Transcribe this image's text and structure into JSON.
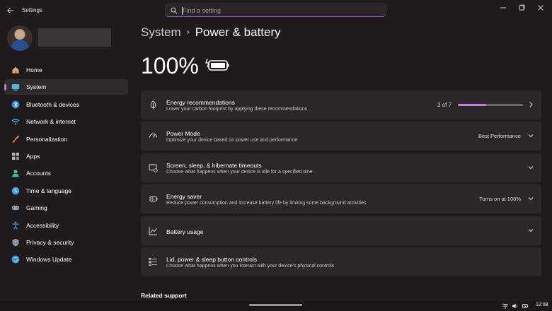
{
  "window": {
    "title": "Settings",
    "back_icon": "back-arrow-icon",
    "controls": [
      "minimize-icon",
      "maximize-icon",
      "close-icon"
    ]
  },
  "search": {
    "placeholder": "Find a setting",
    "icon": "search-icon"
  },
  "sidebar": {
    "items": [
      {
        "label": "Home",
        "icon": "home-icon",
        "active": false
      },
      {
        "label": "System",
        "icon": "system-display-icon",
        "active": true
      },
      {
        "label": "Bluetooth & devices",
        "icon": "bluetooth-icon",
        "active": false
      },
      {
        "label": "Network & internet",
        "icon": "wifi-icon",
        "active": false
      },
      {
        "label": "Personalization",
        "icon": "paintbrush-icon",
        "active": false
      },
      {
        "label": "Apps",
        "icon": "apps-icon",
        "active": false
      },
      {
        "label": "Accounts",
        "icon": "accounts-icon",
        "active": false
      },
      {
        "label": "Time & language",
        "icon": "globe-clock-icon",
        "active": false
      },
      {
        "label": "Gaming",
        "icon": "gamepad-icon",
        "active": false
      },
      {
        "label": "Accessibility",
        "icon": "accessibility-icon",
        "active": false
      },
      {
        "label": "Privacy & security",
        "icon": "shield-icon",
        "active": false
      },
      {
        "label": "Windows Update",
        "icon": "windows-update-icon",
        "active": false
      }
    ]
  },
  "breadcrumb": {
    "parent": "System",
    "separator": "›",
    "current": "Power & battery"
  },
  "battery": {
    "percent_label": "100%",
    "icon": "battery-charging-icon"
  },
  "cards": [
    {
      "title": "Energy recommendations",
      "description": "Lower your carbon footprint by applying these recommendations",
      "icon": "leaf-icon",
      "value": "",
      "progress_label": "3 of 7",
      "progress_fraction": 0.43,
      "chevron": "right"
    },
    {
      "title": "Power Mode",
      "description": "Optimize your device based on power use and performance",
      "icon": "power-mode-icon",
      "value": "Best Performance",
      "chevron": "down"
    },
    {
      "title": "Screen, sleep, & hibernate timeouts",
      "description": "Choose what happens when your device is idle for a specified time",
      "icon": "screen-sleep-icon",
      "value": "",
      "chevron": "down"
    },
    {
      "title": "Energy saver",
      "description": "Reduce power consumption and increase battery life by limiting some background activities",
      "icon": "energy-saver-icon",
      "value": "Turns on at 100%",
      "chevron": "down"
    },
    {
      "title": "Battery usage",
      "description": "",
      "icon": "battery-usage-chart-icon",
      "value": "",
      "chevron": "down"
    },
    {
      "title": "Lid, power & sleep button controls",
      "description": "Choose what happens when you interact with your device's physical controls",
      "icon": "button-controls-icon",
      "value": "",
      "chevron": "none"
    }
  ],
  "related_support": "Related support",
  "taskbar": {
    "clock": "12:08",
    "tray_icons": [
      "wifi-icon",
      "volume-icon",
      "battery-icon"
    ]
  },
  "colors": {
    "background": "#1f1a1b",
    "card": "#2b2627",
    "accent": "#c07fd8"
  }
}
